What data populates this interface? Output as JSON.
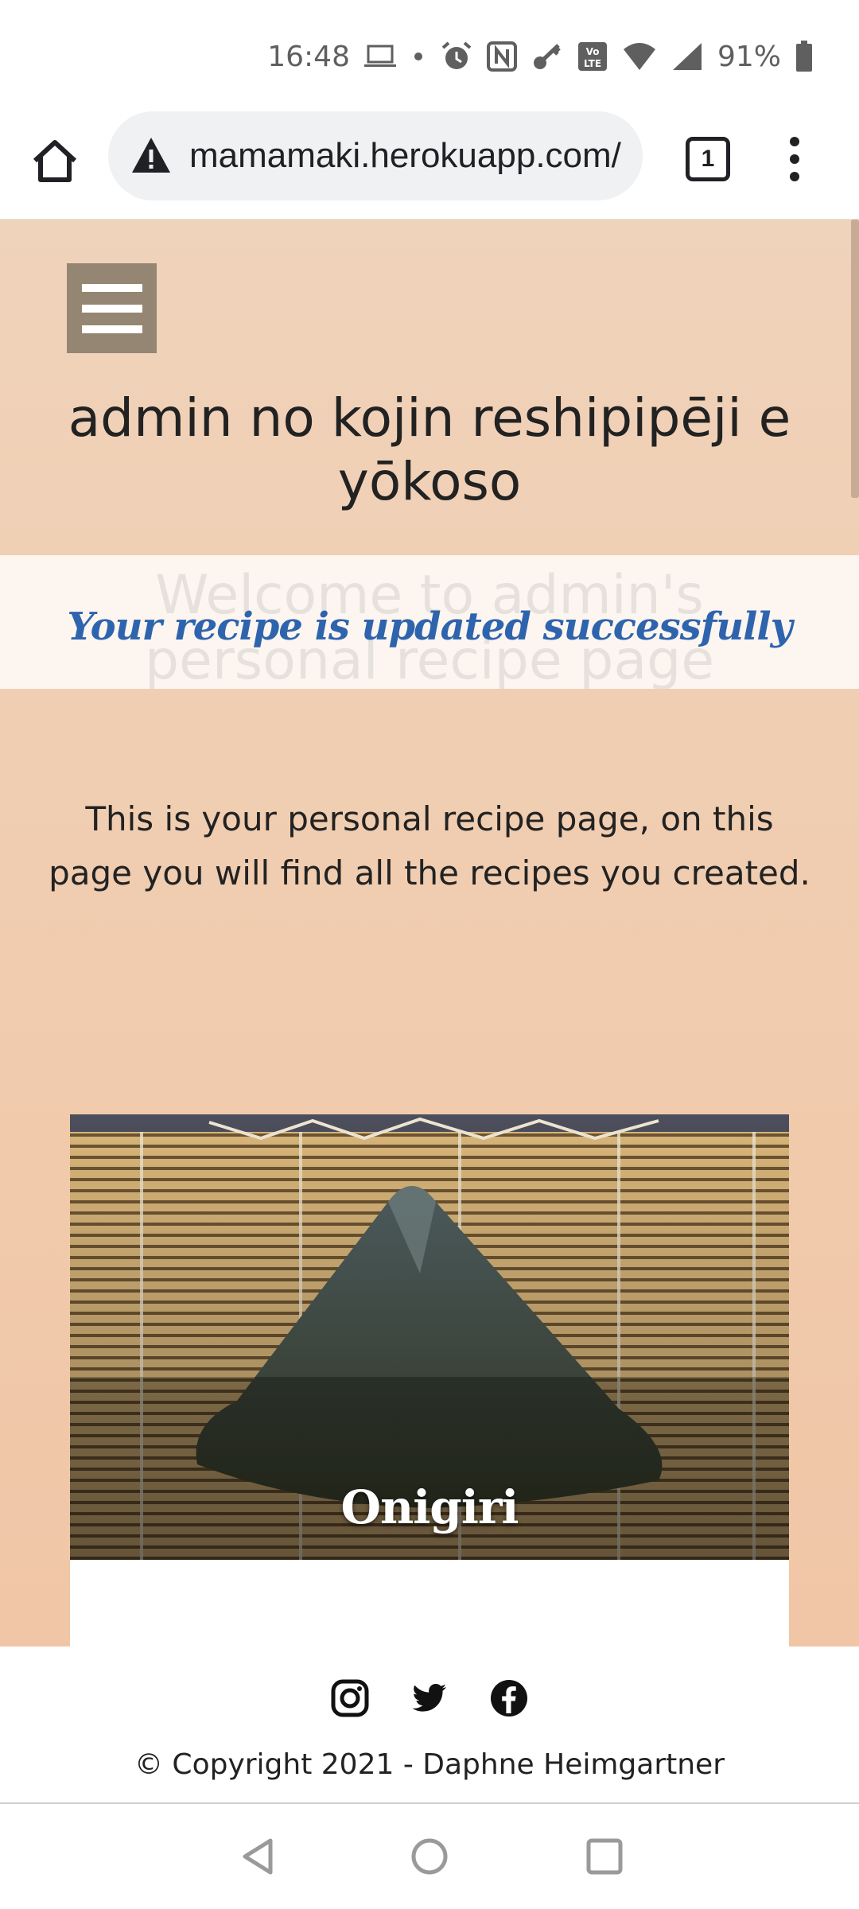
{
  "status_bar": {
    "time": "16:48",
    "battery": "91%",
    "icons": [
      "laptop-icon",
      "dot-icon",
      "alarm-icon",
      "nfc-icon",
      "key-icon",
      "volte-icon",
      "wifi-icon",
      "signal-icon",
      "battery-icon"
    ]
  },
  "browser": {
    "url": "mamamaki.herokuapp.com/",
    "tab_count": "1"
  },
  "page": {
    "title": "admin no kojin reshipipēji e yōkoso",
    "flash_background_text": "Welcome to admin's personal recipe page",
    "flash_message": "Your recipe is updated successfully",
    "intro": "This is your personal recipe page, on this page you will find all the recipes you created.",
    "recipes": [
      {
        "name": "Onigiri"
      }
    ]
  },
  "footer": {
    "copyright": "© Copyright 2021 - Daphne Heimgartner",
    "social": [
      "instagram-icon",
      "twitter-icon",
      "facebook-icon"
    ]
  },
  "colors": {
    "page_background": "#f1cfb3",
    "hamburger": "#958573",
    "flash_text": "#2e64ad"
  }
}
